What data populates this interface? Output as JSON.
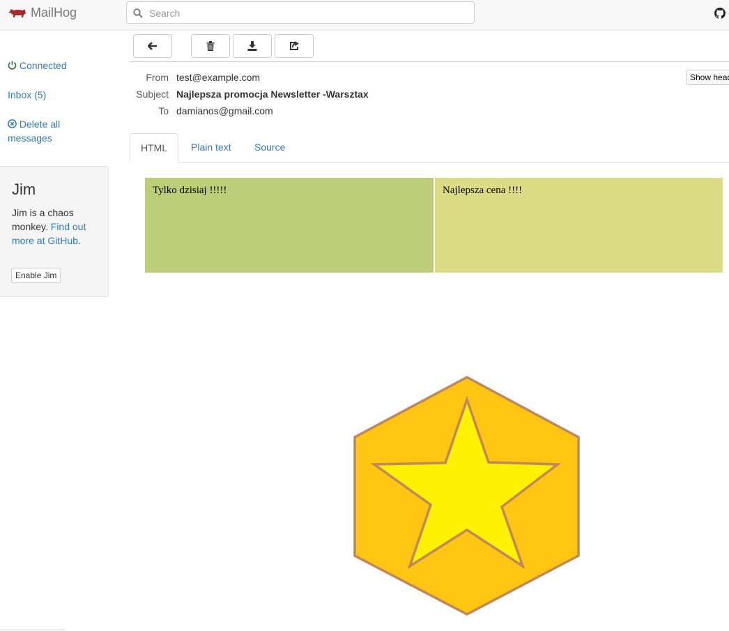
{
  "app": {
    "brand": "MailHog"
  },
  "search": {
    "placeholder": "Search"
  },
  "sidebar": {
    "connected": "Connected",
    "inbox": "Inbox (5)",
    "delete_all": "Delete all messages"
  },
  "jim": {
    "title": "Jim",
    "desc": "Jim is a chaos monkey.",
    "link": "Find out more at GitHub",
    "link_suffix": ".",
    "button": "Enable Jim"
  },
  "toolbar": {
    "icons": [
      "arrow-left-icon",
      "trash-icon",
      "download-icon",
      "share-icon"
    ]
  },
  "message": {
    "from_label": "From",
    "from": "test@example.com",
    "subject_label": "Subject",
    "subject": "Najlepsza promocja Newsletter -Warsztax",
    "to_label": "To",
    "to": "damianos@gmail.com",
    "show_headers": "Show headers"
  },
  "tabs": [
    {
      "label": "HTML",
      "active": true
    },
    {
      "label": "Plain text",
      "active": false
    },
    {
      "label": "Source",
      "active": false
    }
  ],
  "email_body": {
    "left_cell": "Tylko dzisiaj !!!!!",
    "right_cell": "Najlepsza cena !!!!",
    "badge": "star-hexagon-badge"
  },
  "colors": {
    "connected": "#3c763d",
    "link": "#337ab7",
    "cell_left": "#bccf78",
    "cell_right": "#dcdc87",
    "hex_fill": "#fec512",
    "star_fill": "#fff200",
    "outline": "#c0875a"
  }
}
